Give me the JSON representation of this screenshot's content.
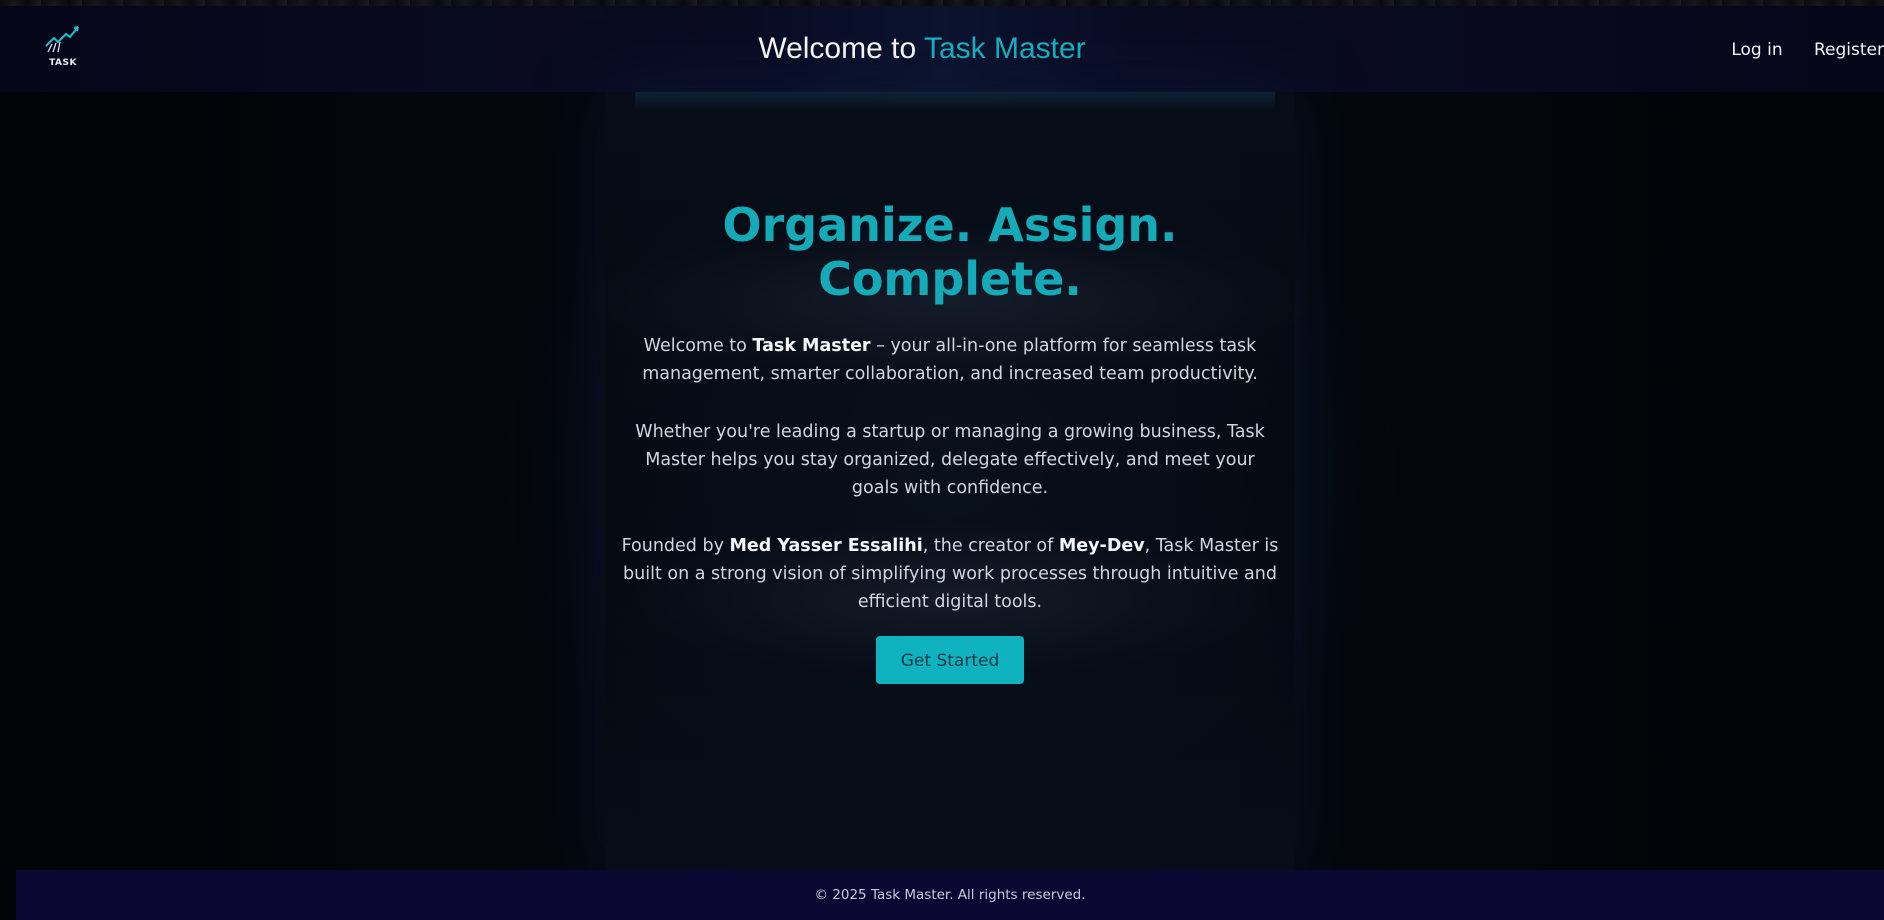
{
  "header": {
    "logo_text": "TASK",
    "title_prefix": "Welcome to",
    "title_brand": "Task Master",
    "nav": {
      "login": "Log in",
      "register": "Register"
    }
  },
  "hero": {
    "headline": "Organize. Assign. Complete.",
    "p1_before": "Welcome to ",
    "p1_bold": "Task Master",
    "p1_after": " – your all-in-one platform for seamless task management, smarter collaboration, and increased team productivity.",
    "p2": "Whether you're leading a startup or managing a growing business, Task Master helps you stay organized, delegate effectively, and meet your goals with confidence.",
    "p3_before": "Founded by ",
    "p3_founder": "Med Yasser Essalihi",
    "p3_middle": ", the creator of ",
    "p3_company": "Mey-Dev",
    "p3_after": ", Task Master is built on a strong vision of simplifying work processes through intuitive and efficient digital tools.",
    "cta_label": "Get Started"
  },
  "footer": {
    "copyright": "© 2025 Task Master. All rights reserved."
  },
  "colors": {
    "accent": "#14aab7",
    "button": "#0fb3bf",
    "footer_bg": "#0c0633",
    "header_bg": "#0a0c24"
  },
  "icons": {
    "logo": "task-logo-icon"
  }
}
